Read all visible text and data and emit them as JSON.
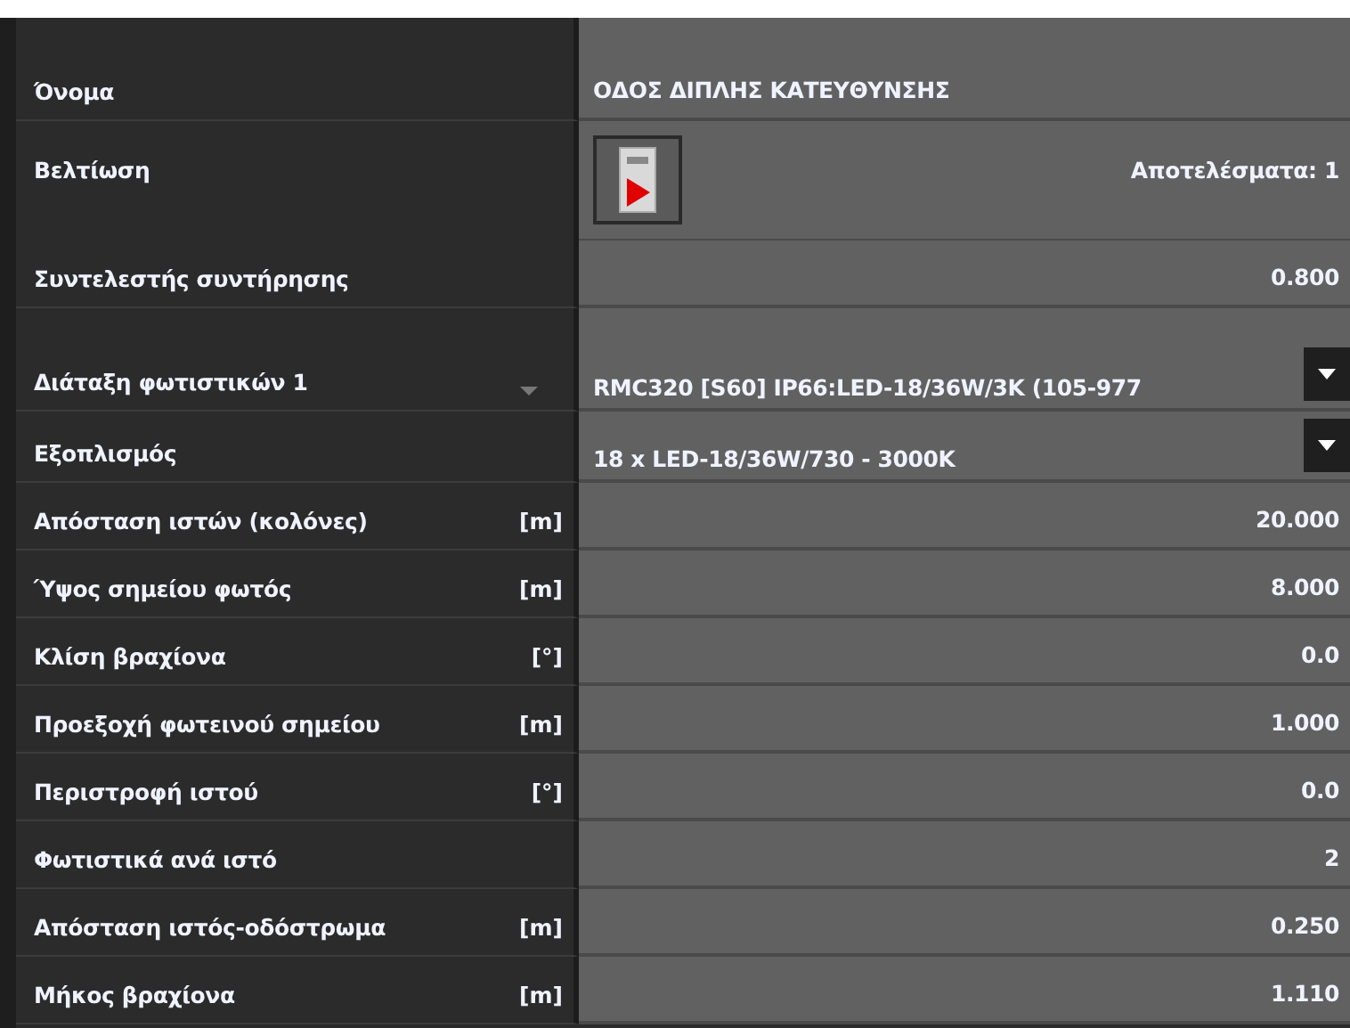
{
  "rows": [
    {
      "kind": "name",
      "label": "Όνομα",
      "value": "ΟΔΟΣ ΔΙΠΛΗΣ ΚΑΤΕΥΘΥΝΣΗΣ"
    },
    {
      "kind": "optimize",
      "label": "Βελτίωση",
      "result": "Αποτελέσματα: 1"
    },
    {
      "kind": "number",
      "label": "Συντελεστής συντήρησης",
      "value": "0.800"
    },
    {
      "kind": "group-select",
      "label": "Διάταξη φωτιστικών 1",
      "expanded": true,
      "value": "RMC320 [S60] IP66:LED-18/36W/3K (105-977"
    },
    {
      "kind": "select",
      "label": "Εξοπλισμός",
      "value": "18 x LED-18/36W/730 - 3000K"
    },
    {
      "kind": "number",
      "label": "Απόσταση ιστών (κολόνες)",
      "unit": "[m]",
      "value": "20.000"
    },
    {
      "kind": "number",
      "label": "Ύψος σημείου φωτός",
      "unit": "[m]",
      "value": "8.000"
    },
    {
      "kind": "number",
      "label": "Κλίση βραχίονα",
      "unit": "[°]",
      "value": "0.0"
    },
    {
      "kind": "number",
      "label": "Προεξοχή φωτεινού σημείου",
      "unit": "[m]",
      "value": "1.000"
    },
    {
      "kind": "number",
      "label": "Περιστροφή ιστού",
      "unit": "[°]",
      "value": "0.0"
    },
    {
      "kind": "number",
      "label": "Φωτιστικά ανά ιστό",
      "value": "2"
    },
    {
      "kind": "number",
      "label": "Απόσταση ιστός-οδόστρωμα",
      "unit": "[m]",
      "value": "0.250"
    },
    {
      "kind": "number",
      "label": "Μήκος βραχίονα",
      "unit": "[m]",
      "value": "1.110"
    }
  ]
}
